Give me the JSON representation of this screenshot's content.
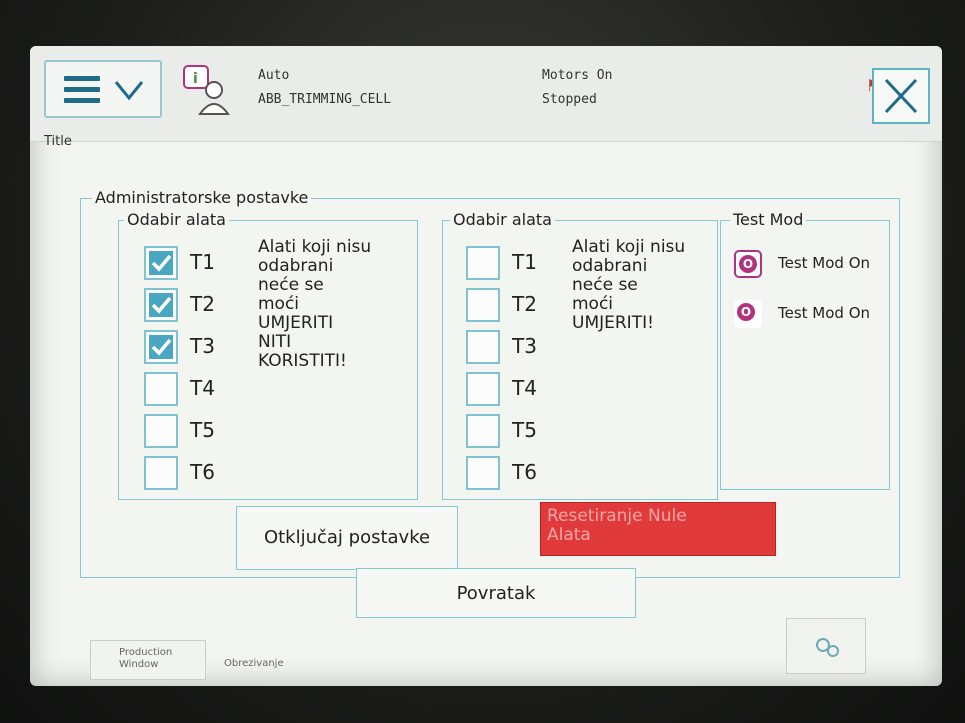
{
  "header": {
    "mode": "Auto",
    "controller": "ABB_TRIMMING_CELL",
    "motors": "Motors On",
    "state": "Stopped",
    "title": "Title"
  },
  "main": {
    "group_title": "Administratorske postavke",
    "left_panel": {
      "title": "Odabir alata",
      "tools": [
        {
          "label": "T1",
          "checked": true
        },
        {
          "label": "T2",
          "checked": true
        },
        {
          "label": "T3",
          "checked": true
        },
        {
          "label": "T4",
          "checked": false
        },
        {
          "label": "T5",
          "checked": false
        },
        {
          "label": "T6",
          "checked": false
        }
      ],
      "warning_lines": [
        "Alati koji nisu",
        "odabrani",
        "neće se",
        "moći",
        "UMJERITI",
        "NITI",
        "KORISTITI!"
      ]
    },
    "right_panel": {
      "title": "Odabir alata",
      "tools": [
        {
          "label": "T1",
          "checked": false
        },
        {
          "label": "T2",
          "checked": false
        },
        {
          "label": "T3",
          "checked": false
        },
        {
          "label": "T4",
          "checked": false
        },
        {
          "label": "T5",
          "checked": false
        },
        {
          "label": "T6",
          "checked": false
        }
      ],
      "warning_lines": [
        "Alati koji nisu",
        "odabrani",
        "neće se",
        "moći",
        "UMJERITI!"
      ]
    },
    "test_mode": {
      "title": "Test Mod",
      "options": [
        {
          "label": "Test Mod On",
          "glyph": "O",
          "selected": true
        },
        {
          "label": "Test Mod On",
          "glyph": "O",
          "selected": false
        }
      ]
    },
    "unlock_button": "Otključaj postavke",
    "reset_button_lines": [
      "Resetiranje Nule",
      "Alata"
    ],
    "back_button": "Povratak"
  },
  "footer": {
    "tabs": [
      {
        "label_lines": [
          "Production",
          "Window"
        ]
      },
      {
        "label_lines": [
          "Obrezivanje"
        ]
      }
    ]
  },
  "colors": {
    "accent": "#4aa7c2",
    "border": "#86c8d2",
    "danger": "#e03a3a",
    "radio": "#b0337d"
  }
}
